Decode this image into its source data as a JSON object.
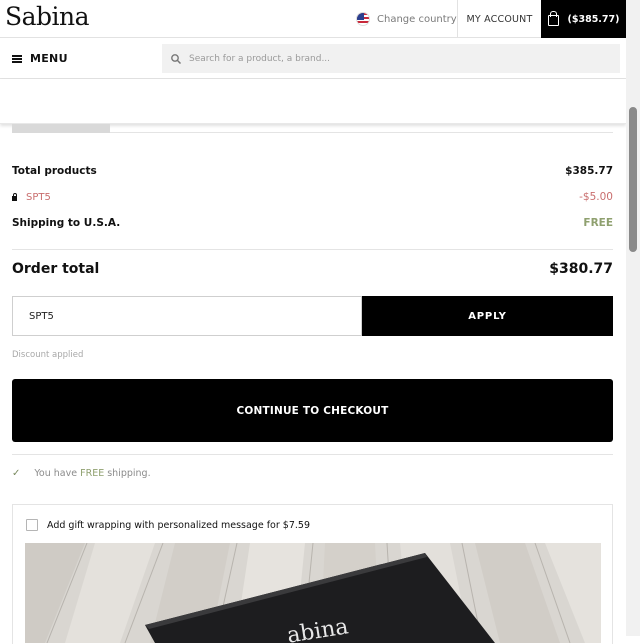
{
  "header": {
    "logo": "Sabina",
    "change_country": "Change country",
    "my_account": "MY ACCOUNT",
    "cart_total": "($385.77)"
  },
  "nav": {
    "menu_label": "MENU",
    "search_placeholder": "Search for a product, a brand..."
  },
  "summary": {
    "total_products_label": "Total products",
    "total_products_value": "$385.77",
    "discount_code": "SPT5",
    "discount_value": "-$5.00",
    "shipping_label": "Shipping to U.S.A.",
    "shipping_value": "FREE",
    "order_total_label": "Order total",
    "order_total_value": "$380.77"
  },
  "coupon": {
    "value": "SPT5",
    "apply_label": "APPLY",
    "status": "Discount applied"
  },
  "checkout_label": "CONTINUE TO CHECKOUT",
  "shipping_note": {
    "prefix": "You have ",
    "highlight": "FREE",
    "suffix": " shipping."
  },
  "gift": {
    "label": "Add gift wrapping with personalized message for $7.59",
    "box_text": "abina"
  },
  "colors": {
    "accent": "#000000",
    "discount": "#c96e6e",
    "free": "#8fa06f"
  },
  "icons": [
    "us-flag-icon",
    "shopping-bag-icon",
    "hamburger-icon",
    "search-icon",
    "lock-icon",
    "check-icon"
  ]
}
